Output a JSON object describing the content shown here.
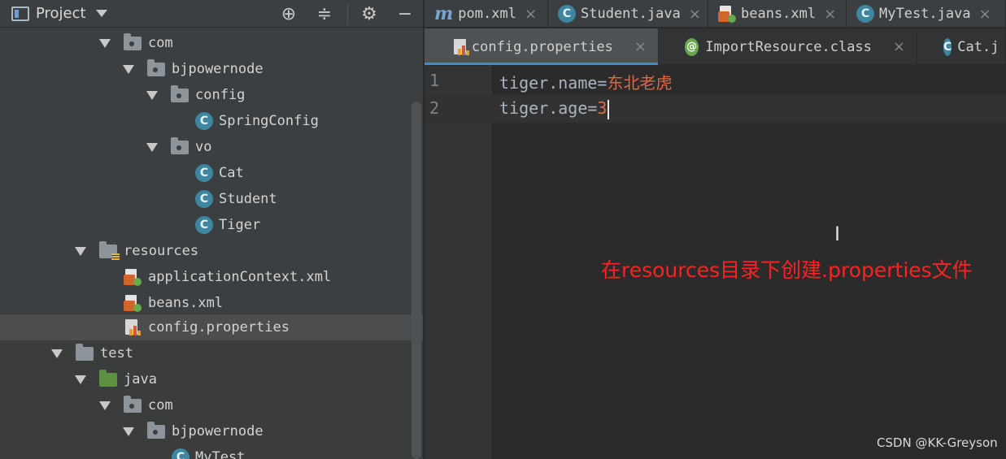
{
  "project_panel": {
    "title": "Project",
    "tree": [
      {
        "label": "com",
        "type": "package"
      },
      {
        "label": "bjpowernode",
        "type": "package"
      },
      {
        "label": "config",
        "type": "package"
      },
      {
        "label": "SpringConfig",
        "type": "class",
        "icon_letter": "C"
      },
      {
        "label": "vo",
        "type": "package"
      },
      {
        "label": "Cat",
        "type": "class",
        "icon_letter": "C"
      },
      {
        "label": "Student",
        "type": "class",
        "icon_letter": "C"
      },
      {
        "label": "Tiger",
        "type": "class",
        "icon_letter": "C"
      },
      {
        "label": "resources",
        "type": "resources-folder"
      },
      {
        "label": "applicationContext.xml",
        "type": "xml"
      },
      {
        "label": "beans.xml",
        "type": "xml"
      },
      {
        "label": "config.properties",
        "type": "properties",
        "selected": true
      },
      {
        "label": "test",
        "type": "folder"
      },
      {
        "label": "java",
        "type": "source-folder"
      },
      {
        "label": "com",
        "type": "package"
      },
      {
        "label": "bjpowernode",
        "type": "package"
      },
      {
        "label": "MyTest",
        "type": "class",
        "icon_letter": "C"
      }
    ]
  },
  "file_tabs": [
    {
      "label": "pom.xml",
      "icon": "maven-icon",
      "icon_letter": "m"
    },
    {
      "label": "Student.java",
      "icon": "class-icon",
      "icon_letter": "C"
    },
    {
      "label": "beans.xml",
      "icon": "xml-icon"
    },
    {
      "label": "MyTest.java",
      "icon": "class-icon",
      "icon_letter": "C"
    }
  ],
  "editor_tabs": [
    {
      "label": "config.properties",
      "icon": "properties-icon",
      "active": true
    },
    {
      "label": "ImportResource.class",
      "icon": "annotation-icon",
      "icon_letter": "@"
    },
    {
      "label": "Cat.j",
      "icon": "class-icon",
      "icon_letter": "C"
    }
  ],
  "editor": {
    "line_numbers": [
      "1",
      "2"
    ],
    "lines": [
      {
        "key": "tiger.name=",
        "value": "东北老虎"
      },
      {
        "key": "tiger.age=",
        "value": "3"
      }
    ]
  },
  "annotation": "在resources目录下创建.properties文件",
  "watermark": "CSDN @KK-Greyson",
  "colors": {
    "panel_bg": "#3c3f41",
    "editor_bg": "#2b2b2b",
    "value_color": "#e0674a",
    "annotation_color": "#ff2222",
    "selection": "#4b4d4f"
  }
}
